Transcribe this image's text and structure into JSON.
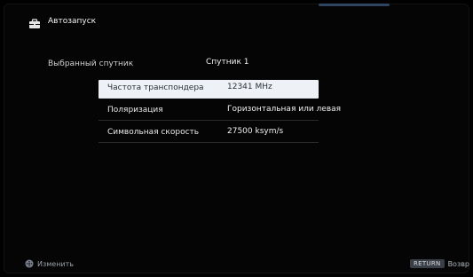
{
  "header": {
    "title": "Автозапуск",
    "icon": "toolbox-icon"
  },
  "selected_satellite": {
    "label": "Выбранный спутник",
    "value": "Спутник 1"
  },
  "settings": [
    {
      "label": "Частота транспондера",
      "value": "12341 MHz",
      "active": true
    },
    {
      "label": "Поляризация",
      "value": "Горизонтальная или левая",
      "active": false
    },
    {
      "label": "Символьная скорость",
      "value": "27500 ksym/s",
      "active": false
    }
  ],
  "footer": {
    "change_label": "Изменить",
    "change_icon": "dpad-icon",
    "return_key": "RETURN",
    "back_label": "Возвр"
  },
  "colors": {
    "highlight": "#eef2f6",
    "background": "#050505",
    "text": "#e6e6e6"
  }
}
